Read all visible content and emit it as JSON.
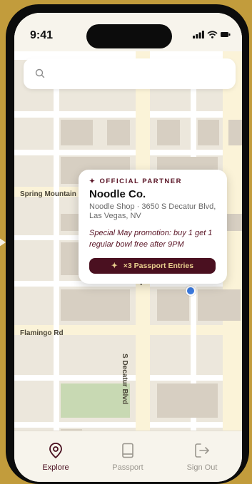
{
  "status_bar": {
    "time": "9:41"
  },
  "search": {
    "placeholder": "",
    "value": ""
  },
  "map": {
    "street_labels": {
      "spring_mountain": "Spring Mountain",
      "flamingo": "Flamingo Rd",
      "decatur": "S Decatur Blvd",
      "partial_v": "V"
    }
  },
  "popup": {
    "badge_icon": "sparkle-icon",
    "badge": "OFFICIAL PARTNER",
    "title": "Noodle Co.",
    "address": "Noodle Shop · 3650 S Decatur Blvd, Las Vegas, NV",
    "promo": "Special May promotion: buy 1 get 1 regular bowl free after 9PM",
    "cta": "×3 Passport Entries",
    "cta_icon": "sparkle-icon"
  },
  "tabs": [
    {
      "label": "Explore",
      "icon": "map-pin-icon",
      "active": true
    },
    {
      "label": "Passport",
      "icon": "book-icon",
      "active": false
    },
    {
      "label": "Sign Out",
      "icon": "sign-out-icon",
      "active": false
    }
  ],
  "colors": {
    "background": "#c29c3c",
    "brand": "#4a1020",
    "cta_text": "#e9cf8e",
    "user_location": "#3b7ae0",
    "map_road": "#ffffff",
    "map_major_road": "#fbf3d8",
    "map_block": "#d7cfc2",
    "map_park": "#c8d9b3"
  }
}
